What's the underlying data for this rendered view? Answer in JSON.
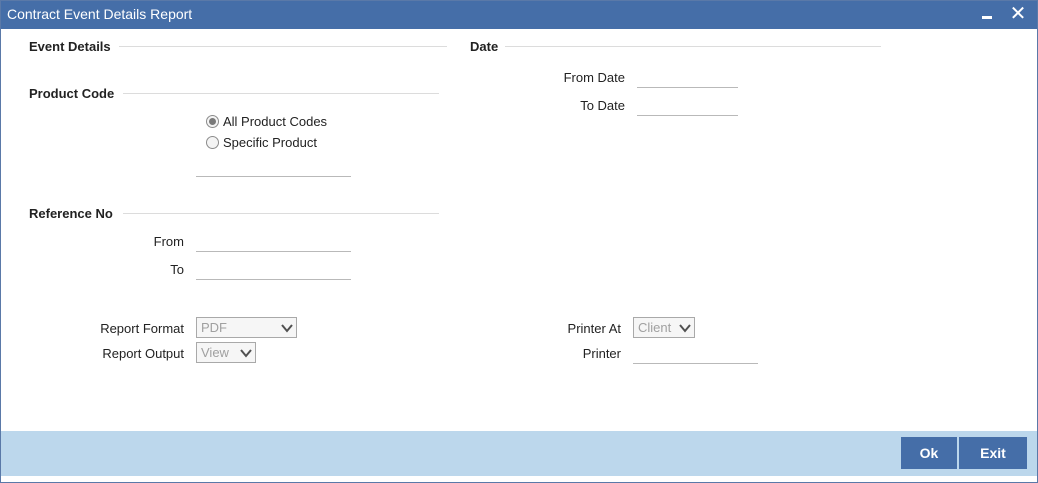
{
  "window": {
    "title": "Contract Event Details Report",
    "minimize_icon": "minimize-icon",
    "close_icon": "close-icon",
    "close_glyph": "✕"
  },
  "event_details": {
    "heading": "Event Details"
  },
  "date": {
    "heading": "Date",
    "from_label": "From Date",
    "from_value": "",
    "to_label": "To Date",
    "to_value": ""
  },
  "product_code": {
    "heading": "Product Code",
    "options": [
      {
        "label": "All Product Codes",
        "selected": true
      },
      {
        "label": "Specific Product",
        "selected": false
      }
    ],
    "specific_value": ""
  },
  "reference_no": {
    "heading": "Reference No",
    "from_label": "From",
    "from_value": "",
    "to_label": "To",
    "to_value": ""
  },
  "report": {
    "format_label": "Report Format",
    "format_value": "PDF",
    "output_label": "Report Output",
    "output_value": "View",
    "printer_at_label": "Printer At",
    "printer_at_value": "Client",
    "printer_label": "Printer",
    "printer_value": ""
  },
  "footer": {
    "ok_label": "Ok",
    "exit_label": "Exit"
  },
  "colors": {
    "title_bar": "#456ea8",
    "footer_band": "#bcd7ec",
    "button": "#456ea8"
  }
}
